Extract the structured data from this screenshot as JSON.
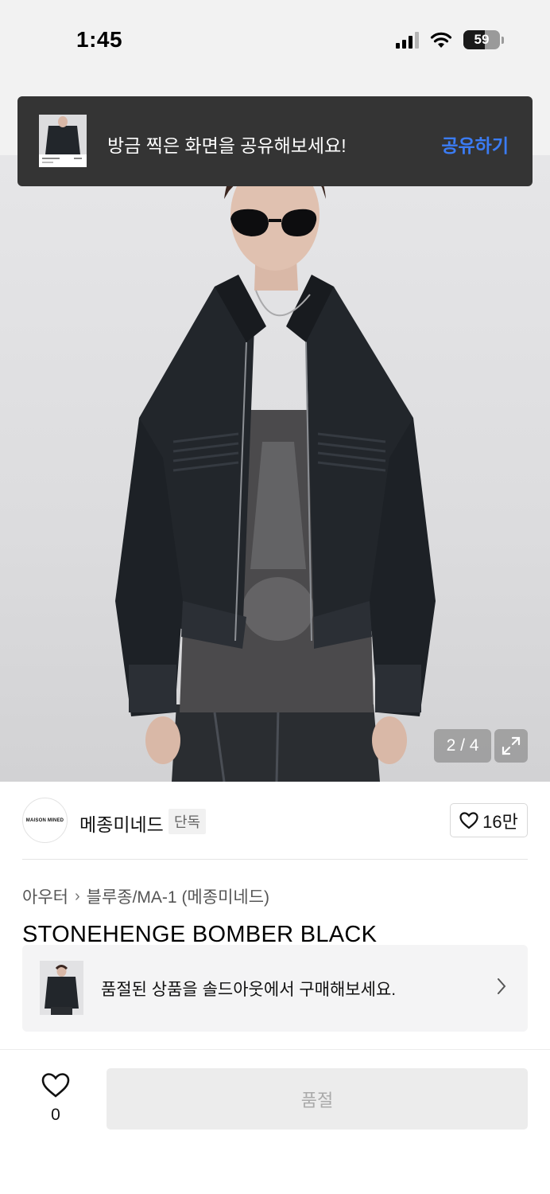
{
  "status_bar": {
    "time": "1:45",
    "battery": "59",
    "icons": [
      "cellular-signal-icon",
      "wifi-icon",
      "battery-icon"
    ]
  },
  "toast": {
    "message": "방금 찍은 화면을 공유해보세요!",
    "action": "공유하기",
    "action_color": "#3b7cf5"
  },
  "gallery": {
    "counter": "2 / 4",
    "current_image": 2,
    "total_images": 4
  },
  "brand": {
    "logo_text": "MAISON MINED",
    "name": "메종미네드",
    "badge": "단독",
    "likes": "16만"
  },
  "breadcrumb": {
    "category": "아우터",
    "subcategory": "블루종/MA-1 (메종미네드)"
  },
  "product": {
    "title": "STONEHENGE BOMBER BLACK"
  },
  "soldout_banner": {
    "text": "품절된 상품을 솔드아웃에서 구매해보세요."
  },
  "bottom_bar": {
    "wish_count": "0",
    "button_label": "품절"
  }
}
